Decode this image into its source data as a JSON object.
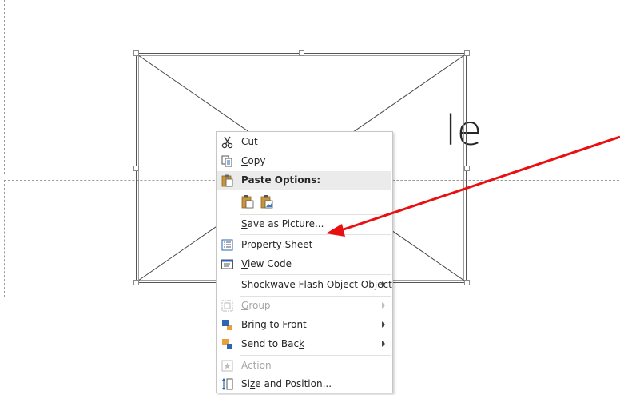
{
  "slide": {
    "title_fragment": "le"
  },
  "context_menu": {
    "cut": {
      "pre": "Cu",
      "key": "t",
      "post": ""
    },
    "copy": {
      "pre": "",
      "key": "C",
      "post": "opy"
    },
    "paste_options": "Paste Options:",
    "save_as_picture": {
      "pre": "",
      "key": "S",
      "post": "ave as Picture..."
    },
    "property_sheet": "Property Sheet",
    "view_code": {
      "pre": "",
      "key": "V",
      "post": "iew Code"
    },
    "shockwave": {
      "pre": "Shockwave Flash Object ",
      "key": "O",
      "post": "bject"
    },
    "group": {
      "pre": "",
      "key": "G",
      "post": "roup"
    },
    "bring_to_front": {
      "pre": "Bring to F",
      "key": "r",
      "post": "ont"
    },
    "send_to_back": {
      "pre": "Send to Bac",
      "key": "k",
      "post": ""
    },
    "action": "Action",
    "size_and_position": {
      "pre": "Si",
      "key": "z",
      "post": "e and Position..."
    }
  },
  "colors": {
    "arrow": "#e81010",
    "menu_border": "#c6c6c6",
    "disabled_text": "#a6a6a6"
  }
}
